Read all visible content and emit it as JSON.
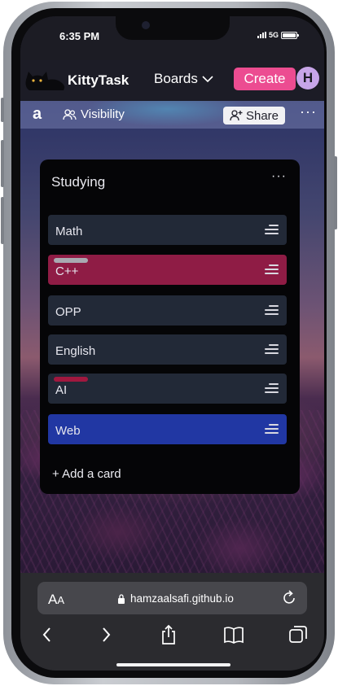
{
  "status": {
    "time": "6:35 PM",
    "network": "5G"
  },
  "nav": {
    "brand": "KittyTask",
    "boards_label": "Boards",
    "create_label": "Create",
    "avatar_initial": "H"
  },
  "board": {
    "name": "a",
    "visibility_label": "Visibility",
    "share_label": "Share",
    "more_label": "···"
  },
  "list": {
    "title": "Studying",
    "more_label": "···",
    "cards": [
      {
        "title": "Math",
        "color": "#222937",
        "label_color": null
      },
      {
        "title": "C++",
        "color": "#8f1c45",
        "label_color": "#a9a9b1"
      },
      {
        "title": "OPP",
        "color": "#222937",
        "label_color": null
      },
      {
        "title": "English",
        "color": "#222937",
        "label_color": null
      },
      {
        "title": "AI",
        "color": "#222937",
        "label_color": "#a0183f"
      },
      {
        "title": "Web",
        "color": "#2137a3",
        "label_color": null
      }
    ],
    "add_card_label": "+ Add a card"
  },
  "safari": {
    "aa_big": "A",
    "aa_small": "A",
    "url": "hamzaalsafi.github.io"
  },
  "colors": {
    "accent": "#ec4c91",
    "avatar": "#c7a5e9",
    "topnav": "#1c1c26"
  }
}
